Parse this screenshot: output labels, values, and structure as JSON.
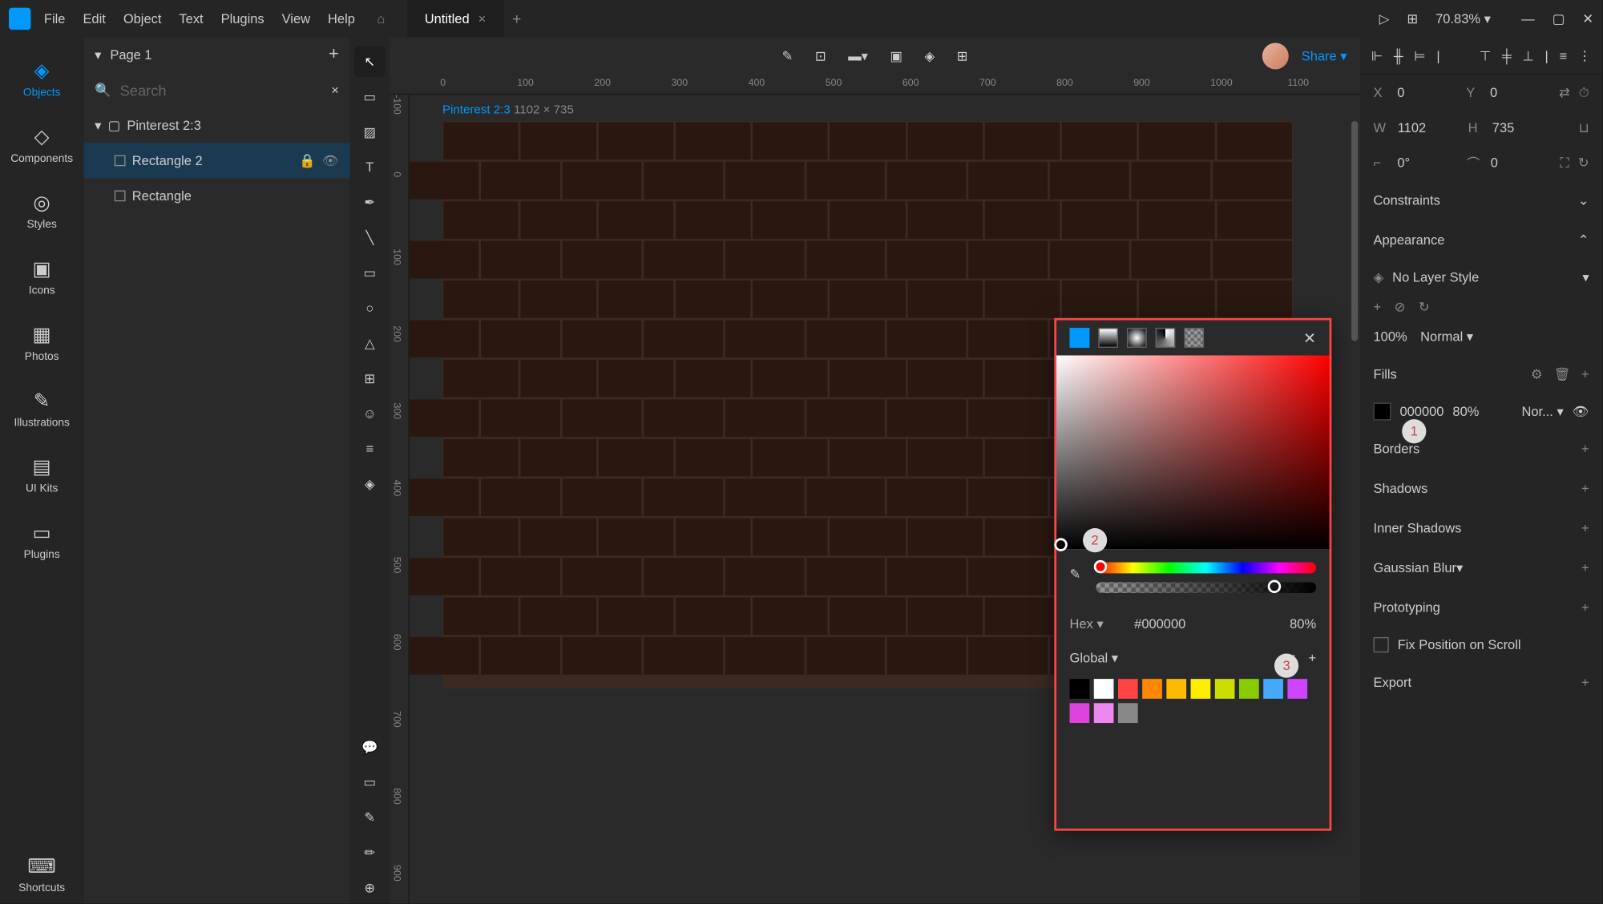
{
  "titlebar": {
    "menus": [
      "File",
      "Edit",
      "Object",
      "Text",
      "Plugins",
      "View",
      "Help"
    ],
    "tab_title": "Untitled",
    "zoom": "70.83%"
  },
  "left_rail": [
    {
      "label": "Objects",
      "active": true
    },
    {
      "label": "Components"
    },
    {
      "label": "Styles"
    },
    {
      "label": "Icons"
    },
    {
      "label": "Photos"
    },
    {
      "label": "Illustrations"
    },
    {
      "label": "UI Kits"
    },
    {
      "label": "Plugins"
    },
    {
      "label": "Shortcuts"
    }
  ],
  "pages": {
    "current": "Page 1",
    "search_placeholder": "Search"
  },
  "layers": [
    {
      "name": "Pinterest 2:3",
      "level": 0,
      "expanded": true
    },
    {
      "name": "Rectangle 2",
      "level": 1,
      "selected": true,
      "locked": true,
      "visible": true
    },
    {
      "name": "Rectangle",
      "level": 1
    }
  ],
  "canvas": {
    "artboard_name": "Pinterest 2:3",
    "artboard_dims": "1102 × 735",
    "ruler_x": [
      "0",
      "100",
      "200",
      "300",
      "400",
      "500",
      "600",
      "700",
      "800",
      "900",
      "1000",
      "1100"
    ],
    "ruler_y": [
      "-100",
      "0",
      "100",
      "200",
      "300",
      "400",
      "500",
      "600",
      "700",
      "800",
      "900"
    ],
    "share": "Share"
  },
  "props": {
    "x": "0",
    "y": "0",
    "w": "1102",
    "h": "735",
    "rotation": "0°",
    "radius": "0",
    "constraints": "Constraints",
    "appearance": "Appearance",
    "layer_style": "No Layer Style",
    "opacity": "100%",
    "blend": "Normal",
    "fills": "Fills",
    "fill_hex": "000000",
    "fill_opacity": "80%",
    "fill_blend": "Nor...",
    "borders": "Borders",
    "shadows": "Shadows",
    "inner_shadows": "Inner Shadows",
    "gaussian": "Gaussian Blur",
    "prototyping": "Prototyping",
    "fix_scroll": "Fix Position on Scroll",
    "export": "Export"
  },
  "color_picker": {
    "hex_label": "Hex",
    "hex_value": "#000000",
    "opacity": "80%",
    "global": "Global",
    "swatches": [
      "#000000",
      "#ffffff",
      "#ff4444",
      "#ff8800",
      "#ffbb00",
      "#ffee00",
      "#ccdd00",
      "#88cc00",
      "#44aaff",
      "#cc44ff",
      "#dd44dd",
      "#ee88ee",
      "#888888"
    ]
  },
  "badges": [
    "1",
    "2",
    "3"
  ]
}
